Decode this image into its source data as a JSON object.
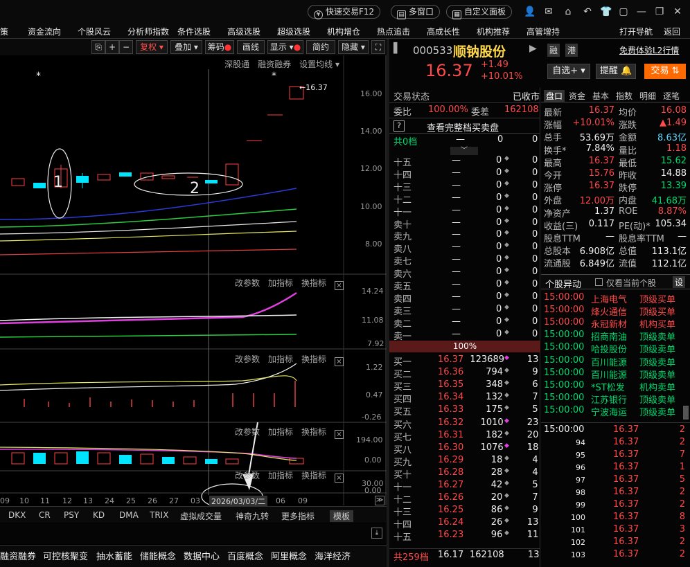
{
  "titlebar": {
    "quick_trade": "快速交易F12",
    "multi_window": "多窗口",
    "custom_panel": "自定义面板"
  },
  "menu": [
    "策",
    "资金流向",
    "个股风云",
    "分析师指数",
    "条件选股",
    "高级选股",
    "超级选股",
    "机构增仓",
    "热点追击",
    "高成长性",
    "机构推荐",
    "高管增持"
  ],
  "menu_right": [
    "打开导航",
    "返回"
  ],
  "chart_toolbar": {
    "fq": "复权",
    "overlay": "叠加",
    "chip": "筹码",
    "draw": "画线",
    "show": "显示",
    "simple": "简约",
    "hide": "隐藏"
  },
  "chart_links": [
    "深股通",
    "融资融券",
    "设置均线"
  ],
  "panel_actions": [
    "改参数",
    "加指标",
    "换指标"
  ],
  "price_axis": [
    "16.00",
    "14.00",
    "12.00",
    "10.00",
    "8.00"
  ],
  "price_label": "16.37",
  "ind1_axis": [
    "14.24",
    "11.08",
    "7.92"
  ],
  "ind2_axis": [
    "1.22",
    "0.47",
    "-0.26"
  ],
  "ind3_axis": [
    "194.00",
    "0.00"
  ],
  "ind4_axis": [
    "30.00",
    "0.00"
  ],
  "annotations": [
    "1",
    "2"
  ],
  "dates": [
    "09",
    "10",
    "11",
    "12",
    "13",
    "24",
    "25",
    "26",
    "27",
    "03",
    "2026/03/03/二",
    "06",
    "09"
  ],
  "indicators": [
    "DKX",
    "CR",
    "PSY",
    "KD",
    "DMA",
    "TRIX",
    "虚拟成交量",
    "神奇九转",
    "更多指标",
    "模板"
  ],
  "concepts": [
    "融资融券",
    "可控核聚变",
    "抽水蓄能",
    "储能概念",
    "数据中心",
    "百度概念",
    "阿里概念",
    "海洋经济"
  ],
  "stock": {
    "code": "000533",
    "name": "顺钠股份",
    "rz": "融",
    "hk": "港",
    "free_l2": "免费体验L2行情",
    "price": "16.37",
    "change": "+1.49",
    "pct": "+10.01%",
    "watch": "自选+",
    "alert": "提醒",
    "trade": "交易"
  },
  "order_book": {
    "status_label": "交易状态",
    "status": "已收市",
    "wb_label": "委比",
    "wb": "100.00%",
    "wc_label": "委差",
    "wc": "162108",
    "full_book": "查看完整档买卖盘",
    "total_sell_label": "共0档",
    "total_sell_a": "—",
    "total_sell_b": "0",
    "total_sell_c": "0",
    "sells": [
      {
        "label": "十五",
        "price": "—",
        "vol": "0",
        "cnt": "0"
      },
      {
        "label": "十四",
        "price": "—",
        "vol": "0",
        "cnt": "0"
      },
      {
        "label": "十三",
        "price": "—",
        "vol": "0",
        "cnt": "0"
      },
      {
        "label": "十二",
        "price": "—",
        "vol": "0",
        "cnt": "0"
      },
      {
        "label": "十一",
        "price": "—",
        "vol": "0",
        "cnt": "0"
      },
      {
        "label": "卖十",
        "price": "—",
        "vol": "0",
        "cnt": "0"
      },
      {
        "label": "卖九",
        "price": "—",
        "vol": "0",
        "cnt": "0"
      },
      {
        "label": "卖八",
        "price": "—",
        "vol": "0",
        "cnt": "0"
      },
      {
        "label": "卖七",
        "price": "—",
        "vol": "0",
        "cnt": "0"
      },
      {
        "label": "卖六",
        "price": "—",
        "vol": "0",
        "cnt": "0"
      },
      {
        "label": "卖五",
        "price": "—",
        "vol": "0",
        "cnt": "0"
      },
      {
        "label": "卖四",
        "price": "—",
        "vol": "0",
        "cnt": "0"
      },
      {
        "label": "卖三",
        "price": "—",
        "vol": "0",
        "cnt": "0"
      },
      {
        "label": "卖二",
        "price": "—",
        "vol": "0",
        "cnt": "0"
      },
      {
        "label": "卖一",
        "price": "—",
        "vol": "0",
        "cnt": "0"
      }
    ],
    "ratio": "100%",
    "buys": [
      {
        "label": "买一",
        "price": "16.37",
        "vol": "123689",
        "cnt": "13"
      },
      {
        "label": "买二",
        "price": "16.36",
        "vol": "794",
        "cnt": "9"
      },
      {
        "label": "买三",
        "price": "16.35",
        "vol": "348",
        "cnt": "6"
      },
      {
        "label": "买四",
        "price": "16.34",
        "vol": "132",
        "cnt": "7"
      },
      {
        "label": "买五",
        "price": "16.33",
        "vol": "175",
        "cnt": "5"
      },
      {
        "label": "买六",
        "price": "16.32",
        "vol": "1010",
        "cnt": "23"
      },
      {
        "label": "买七",
        "price": "16.31",
        "vol": "182",
        "cnt": "20"
      },
      {
        "label": "买八",
        "price": "16.30",
        "vol": "1076",
        "cnt": "18"
      },
      {
        "label": "买九",
        "price": "16.29",
        "vol": "18",
        "cnt": "4"
      },
      {
        "label": "买十",
        "price": "16.28",
        "vol": "28",
        "cnt": "4"
      },
      {
        "label": "十一",
        "price": "16.27",
        "vol": "42",
        "cnt": "5"
      },
      {
        "label": "十二",
        "price": "16.26",
        "vol": "20",
        "cnt": "7"
      },
      {
        "label": "十三",
        "price": "16.25",
        "vol": "86",
        "cnt": "9"
      },
      {
        "label": "十四",
        "price": "16.24",
        "vol": "26",
        "cnt": "13"
      },
      {
        "label": "十五",
        "price": "16.23",
        "vol": "96",
        "cnt": "11"
      }
    ],
    "total_buy_label": "共259档",
    "total_buy_price": "16.17",
    "total_buy_vol": "162108",
    "total_buy_cnt": "13"
  },
  "tabs": [
    "盘口",
    "资金",
    "基本",
    "指数",
    "明细",
    "逐笔"
  ],
  "quote": [
    [
      "最新",
      "16.37",
      "均价",
      "16.08"
    ],
    [
      "涨幅",
      "+10.01%",
      "涨跌",
      "▲1.49"
    ],
    [
      "总手",
      "53.69万",
      "金额",
      "8.63亿"
    ],
    [
      "换手*",
      "7.84%",
      "量比",
      "1.18"
    ],
    [
      "最高",
      "16.37",
      "最低",
      "15.62"
    ],
    [
      "今开",
      "15.76",
      "昨收",
      "14.88"
    ],
    [
      "涨停",
      "16.37",
      "跌停",
      "13.39"
    ],
    [
      "外盘",
      "12.00万",
      "内盘",
      "41.68万"
    ],
    [
      "净资产",
      "1.37",
      "ROE",
      "8.87%"
    ],
    [
      "收益(三)",
      "0.117",
      "PE(动)*",
      "105.34"
    ],
    [
      "股息TTM",
      "—",
      "股息率TTM",
      "—"
    ],
    [
      "总股本",
      "6.908亿",
      "总值",
      "113.1亿"
    ],
    [
      "流通股",
      "6.849亿",
      "流值",
      "112.1亿"
    ]
  ],
  "movers": {
    "title": "个股异动",
    "only_current": "仅看当前个股",
    "settings": "设",
    "rows": [
      [
        "15:00:00",
        "上海电气",
        "顶级买单"
      ],
      [
        "15:00:00",
        "烽火通信",
        "顶级买单"
      ],
      [
        "15:00:00",
        "永冠新材",
        "机构买单"
      ],
      [
        "15:00:00",
        "招商南油",
        "顶级卖单"
      ],
      [
        "15:00:00",
        "哈投股份",
        "顶级卖单"
      ],
      [
        "15:00:00",
        "百川能源",
        "顶级卖单"
      ],
      [
        "15:00:00",
        "百川能源",
        "顶级卖单"
      ],
      [
        "15:00:00",
        "*ST松发",
        "机构卖单"
      ],
      [
        "15:00:00",
        "江苏银行",
        "顶级卖单"
      ],
      [
        "15:00:00",
        "宁波海运",
        "顶级卖单"
      ]
    ]
  },
  "ticks": [
    [
      "15:00:00",
      "16.37",
      "2"
    ],
    [
      "94",
      "16.37",
      "2"
    ],
    [
      "95",
      "16.37",
      "7"
    ],
    [
      "96",
      "16.37",
      "1"
    ],
    [
      "97",
      "16.37",
      "5"
    ],
    [
      "98",
      "16.37",
      "2"
    ],
    [
      "99",
      "16.37",
      "2"
    ],
    [
      "100",
      "16.37",
      "8"
    ],
    [
      "101",
      "16.37",
      "3"
    ],
    [
      "102",
      "16.37",
      "2"
    ],
    [
      "103",
      "16.37",
      "2"
    ]
  ]
}
